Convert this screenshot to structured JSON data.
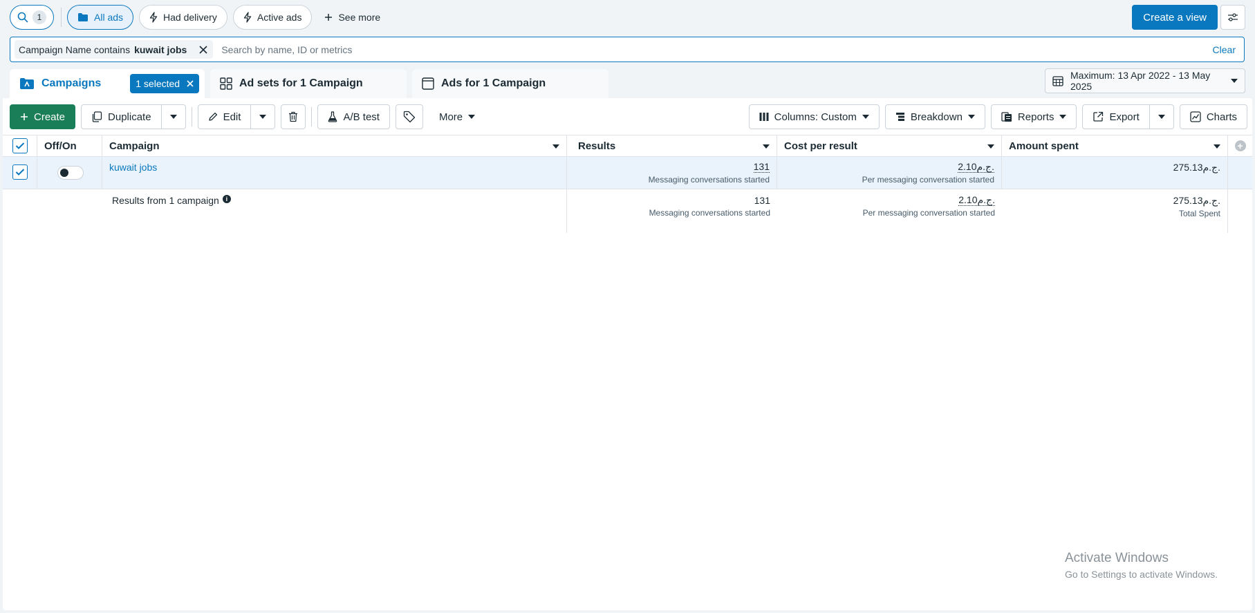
{
  "topbar": {
    "search_count": "1",
    "views": [
      {
        "label": "All ads",
        "icon": "folder-icon",
        "active": true
      },
      {
        "label": "Had delivery",
        "icon": "lightning-icon",
        "active": false
      },
      {
        "label": "Active ads",
        "icon": "lightning-icon",
        "active": false
      }
    ],
    "see_more_label": "See more",
    "create_view_label": "Create a view"
  },
  "filter": {
    "chip_prefix": "Campaign Name contains",
    "chip_value": "kuwait jobs",
    "placeholder": "Search by name, ID or metrics",
    "clear_label": "Clear"
  },
  "tabs": {
    "campaigns": {
      "label": "Campaigns",
      "selected_label": "1 selected"
    },
    "adsets": {
      "label": "Ad sets for 1 Campaign"
    },
    "ads": {
      "label": "Ads for 1 Campaign"
    }
  },
  "date_range": {
    "label": "Maximum: 13 Apr 2022 - 13 May 2025"
  },
  "toolbar": {
    "create_label": "Create",
    "duplicate_label": "Duplicate",
    "edit_label": "Edit",
    "ab_test_label": "A/B test",
    "more_label": "More",
    "columns_label": "Columns: Custom",
    "breakdown_label": "Breakdown",
    "reports_label": "Reports",
    "export_label": "Export",
    "charts_label": "Charts"
  },
  "table": {
    "headers": {
      "toggle": "Off/On",
      "campaign": "Campaign",
      "results": "Results",
      "cost": "Cost per result",
      "amount": "Amount spent"
    },
    "rows": [
      {
        "selected": true,
        "delivery_on": false,
        "campaign": "kuwait jobs",
        "results": "131",
        "results_sub": "Messaging conversations started",
        "cost": "2.10ج.م.",
        "cost_sub": "Per messaging conversation started",
        "amount": "275.13ج.م."
      }
    ],
    "summary": {
      "label": "Results from 1 campaign",
      "results": "131",
      "results_sub": "Messaging conversations started",
      "cost": "2.10ج.م.",
      "cost_sub": "Per messaging conversation started",
      "amount": "275.13ج.م.",
      "amount_sub": "Total Spent"
    }
  },
  "watermark": {
    "line1": "Activate Windows",
    "line2": "Go to Settings to activate Windows."
  }
}
